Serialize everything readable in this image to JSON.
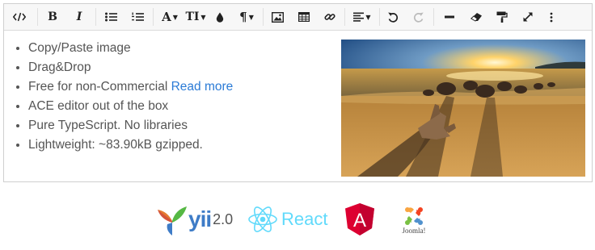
{
  "toolbar": {
    "items": [
      {
        "name": "source-code",
        "glyph": "</>"
      },
      {
        "name": "bold",
        "glyph": "B"
      },
      {
        "name": "italic",
        "glyph": "I"
      },
      {
        "name": "unordered-list"
      },
      {
        "name": "ordered-list"
      },
      {
        "name": "font",
        "glyph": "A"
      },
      {
        "name": "font-size",
        "glyph": "TI"
      },
      {
        "name": "brush-color"
      },
      {
        "name": "paragraph",
        "glyph": "¶"
      },
      {
        "name": "image"
      },
      {
        "name": "table"
      },
      {
        "name": "link"
      },
      {
        "name": "align"
      },
      {
        "name": "undo"
      },
      {
        "name": "redo"
      },
      {
        "name": "horizontal-rule"
      },
      {
        "name": "eraser"
      },
      {
        "name": "copy-format"
      },
      {
        "name": "fullscreen"
      },
      {
        "name": "more-dots"
      }
    ]
  },
  "content": {
    "list": [
      "Copy/Paste image",
      "Drag&Drop",
      "Free for non-Commercial ",
      "ACE editor out of the box",
      "Pure TypeScript. No libraries",
      "Lightweight: ~83.90kB gzipped."
    ],
    "read_more": "Read more"
  },
  "logos": {
    "yii_text": "yii",
    "yii_version": "2.0",
    "react_text": "React",
    "angular_letter": "A",
    "joomla_text": "Joomla!"
  },
  "colors": {
    "link": "#2b7bd6",
    "react": "#61dafb",
    "angular": "#dd0031",
    "yii_blue": "#3e7cc7"
  }
}
